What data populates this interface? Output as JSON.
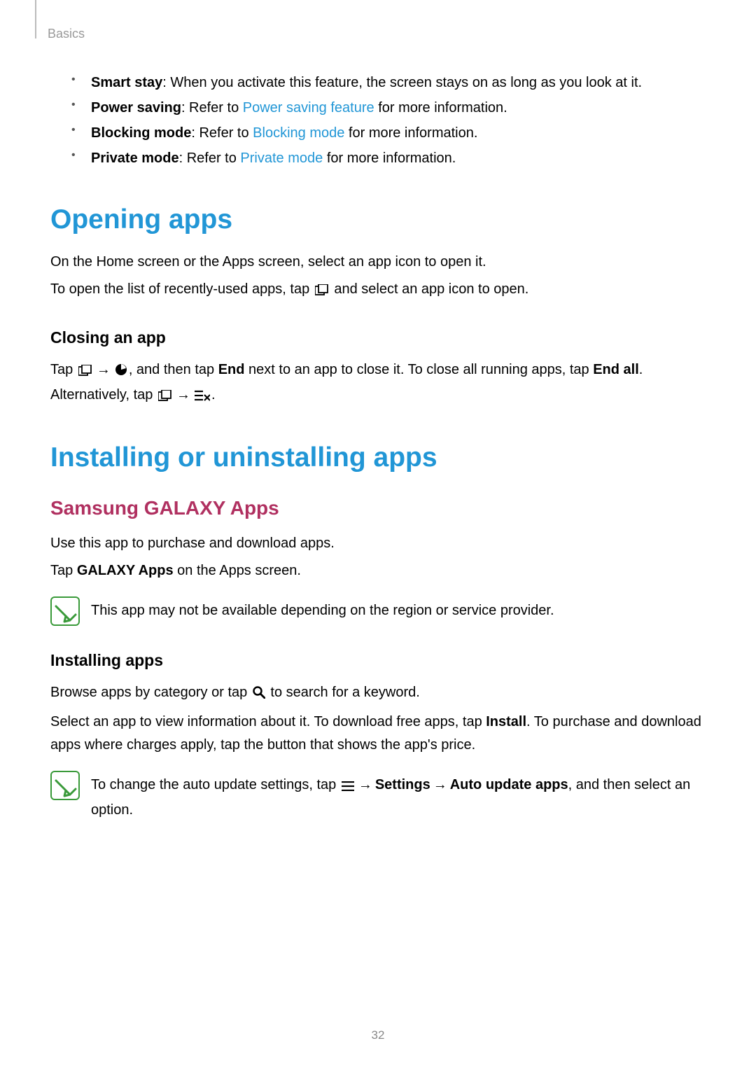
{
  "breadcrumb": "Basics",
  "bullets": [
    {
      "label": "Smart stay",
      "text": ": When you activate this feature, the screen stays on as long as you look at it."
    },
    {
      "label": "Power saving",
      "pre": ": Refer to ",
      "link": "Power saving feature",
      "post": " for more information."
    },
    {
      "label": "Blocking mode",
      "pre": ": Refer to ",
      "link": "Blocking mode",
      "post": " for more information."
    },
    {
      "label": "Private mode",
      "pre": ": Refer to ",
      "link": "Private mode",
      "post": " for more information."
    }
  ],
  "opening": {
    "title": "Opening apps",
    "p1": "On the Home screen or the Apps screen, select an app icon to open it.",
    "p2a": "To open the list of recently-used apps, tap ",
    "p2b": " and select an app icon to open.",
    "closing_title": "Closing an app",
    "c1a": "Tap ",
    "c1b": ", and then tap ",
    "c1_end": "End",
    "c1c": " next to an app to close it. To close all running apps, tap ",
    "c1_endall": "End all",
    "c1d": ". Alternatively, tap ",
    "c1e": "."
  },
  "installing": {
    "title": "Installing or uninstalling apps",
    "galaxy_title": "Samsung GALAXY Apps",
    "g1": "Use this app to purchase and download apps.",
    "g2a": "Tap ",
    "g2_galaxy": "GALAXY Apps",
    "g2b": " on the Apps screen.",
    "note1": "This app may not be available depending on the region or service provider.",
    "install_title": "Installing apps",
    "i1a": "Browse apps by category or tap ",
    "i1b": " to search for a keyword.",
    "i2a": "Select an app to view information about it. To download free apps, tap ",
    "i2_install": "Install",
    "i2b": ". To purchase and download apps where charges apply, tap the button that shows the app's price.",
    "note2a": "To change the auto update settings, tap ",
    "note2_settings": "Settings",
    "note2_auto": "Auto update apps",
    "note2b": ", and then select an option."
  },
  "arrow": "→",
  "page_number": "32"
}
